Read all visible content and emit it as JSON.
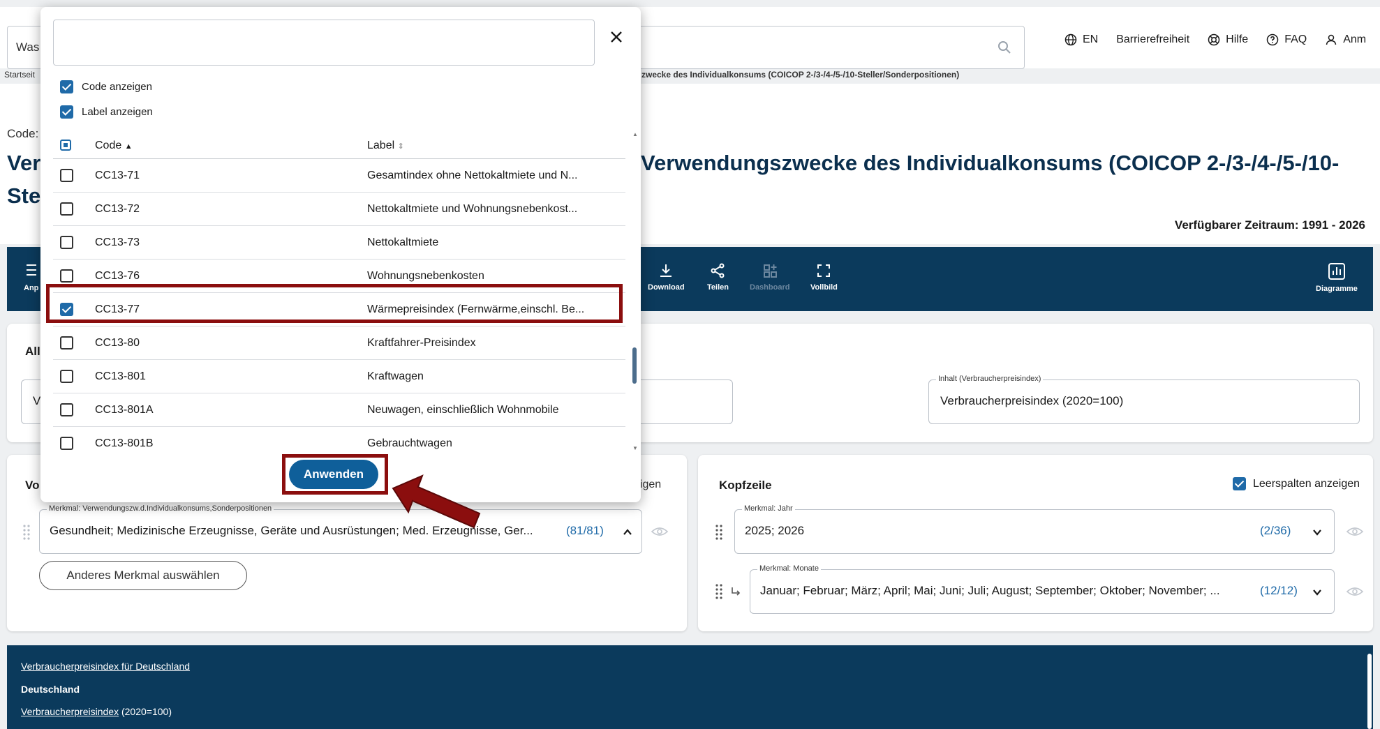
{
  "header": {
    "search_placeholder": "Was",
    "nav": [
      {
        "icon": "globe-icon",
        "label": "EN"
      },
      {
        "icon": "",
        "label": "Barrierefreiheit"
      },
      {
        "icon": "lifebuoy-icon",
        "label": "Hilfe"
      },
      {
        "icon": "question-icon",
        "label": "FAQ"
      },
      {
        "icon": "user-icon",
        "label": "Anm"
      }
    ]
  },
  "breadcrumb": {
    "start": "Startseit",
    "tail": "zwecke des Individualkonsums (COICOP 2-/3-/4-/5-/10-Steller/Sonderpositionen)"
  },
  "page": {
    "code_label": "Code:",
    "title_line1_left": "Ver",
    "title_line1_right": "Verwendungszwecke des Individualkonsums (COICOP 2-/3-/4-/5-/10-",
    "title_line2": "Ste",
    "period": "Verfügbarer Zeitraum: 1991 - 2026"
  },
  "toolbar": {
    "left_label": "Anp",
    "download": "Download",
    "share": "Teilen",
    "dashboard": "Dashboard",
    "fullscreen": "Vollbild",
    "charts": "Diagramme"
  },
  "filter": {
    "heading": "All",
    "left_value": "V",
    "content_legend": "Inhalt (Verbraucherpreisindex)",
    "content_value": "Verbraucherpreisindex (2020=100)"
  },
  "left_card": {
    "title": "Vo",
    "show_label": "eigen",
    "legend": "Merkmal: Verwendungszw.d.Individualkonsums,Sonderpositionen",
    "value": "Gesundheit; Medizinische Erzeugnisse, Geräte und Ausrüstungen; Med. Erzeugnisse, Ger...",
    "count": "(81/81)",
    "other_button": "Anderes Merkmal auswählen"
  },
  "right_card": {
    "title": "Kopfzeile",
    "empty_cols_label": "Leerspalten anzeigen",
    "year_legend": "Merkmal: Jahr",
    "year_value": "2025; 2026",
    "year_count": "(2/36)",
    "month_legend": "Merkmal: Monate",
    "month_value": "Januar; Februar; März; April; Mai; Juni; Juli; August; September; Oktober; November; ...",
    "month_count": "(12/12)"
  },
  "footer": {
    "line1": "Verbraucherpreisindex für Deutschland",
    "line2": "Deutschland",
    "line3_link": "Verbraucherpreisindex",
    "line3_rest": " (2020=100)"
  },
  "modal": {
    "search_value": "",
    "show_code": "Code anzeigen",
    "show_label": "Label anzeigen",
    "col_code": "Code",
    "col_label": "Label",
    "rows": [
      {
        "code": "CC13-71",
        "label": "Gesamtindex ohne Nettokaltmiete und N...",
        "checked": false
      },
      {
        "code": "CC13-72",
        "label": "Nettokaltmiete und Wohnungsnebenkost...",
        "checked": false
      },
      {
        "code": "CC13-73",
        "label": "Nettokaltmiete",
        "checked": false
      },
      {
        "code": "CC13-76",
        "label": "Wohnungsnebenkosten",
        "checked": false
      },
      {
        "code": "CC13-77",
        "label": "Wärmepreisindex (Fernwärme,einschl. Be...",
        "checked": true
      },
      {
        "code": "CC13-80",
        "label": "Kraftfahrer-Preisindex",
        "checked": false
      },
      {
        "code": "CC13-801",
        "label": "Kraftwagen",
        "checked": false
      },
      {
        "code": "CC13-801A",
        "label": "Neuwagen, einschließlich Wohnmobile",
        "checked": false
      },
      {
        "code": "CC13-801B",
        "label": "Gebrauchtwagen",
        "checked": false
      }
    ],
    "apply": "Anwenden"
  },
  "colors": {
    "navy": "#0b3a5c",
    "accent": "#1f6aa8",
    "highlight": "#8b0e0e"
  }
}
